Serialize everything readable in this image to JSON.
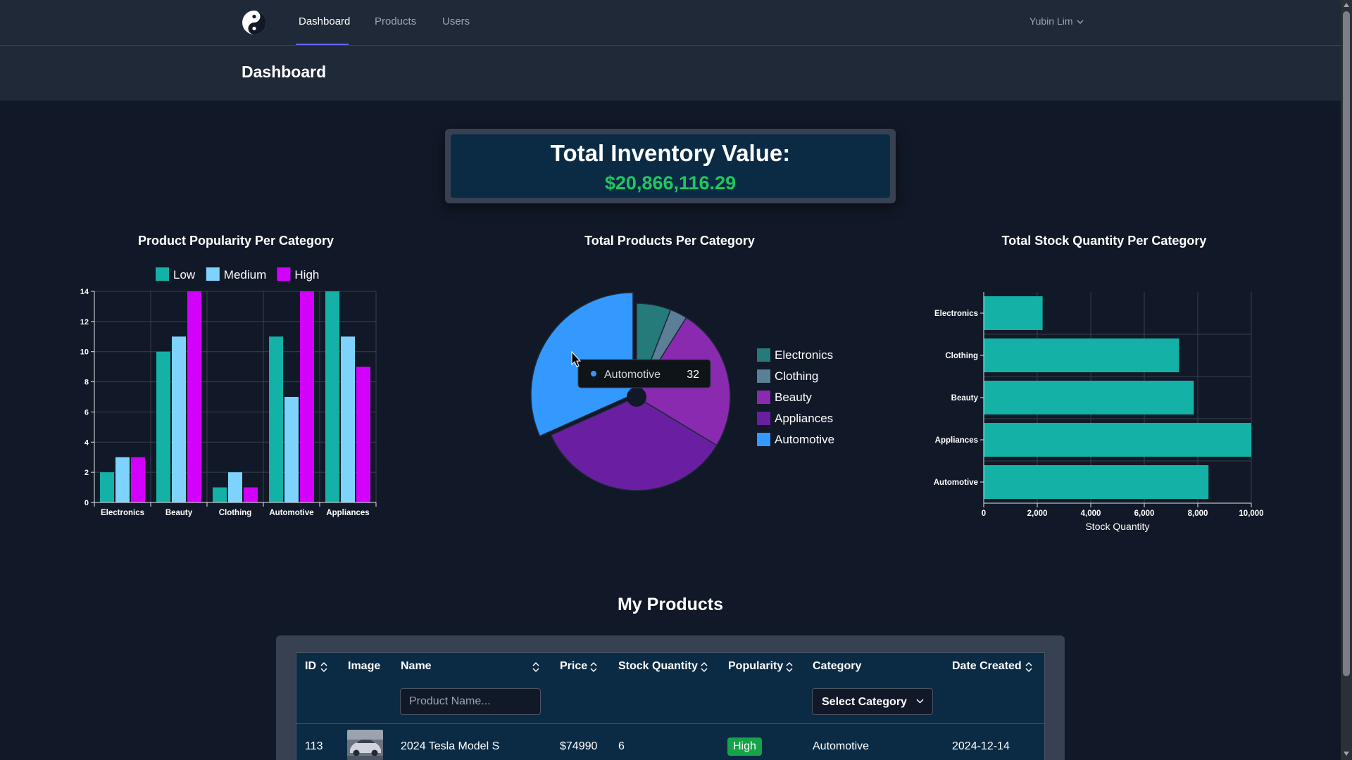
{
  "nav": {
    "logo_icon": "yin-yang-icon",
    "links": [
      {
        "label": "Dashboard",
        "active": true
      },
      {
        "label": "Products",
        "active": false
      },
      {
        "label": "Users",
        "active": false
      }
    ],
    "user_name": "Yubin Lim"
  },
  "header": {
    "title": "Dashboard"
  },
  "inventory": {
    "title": "Total Inventory Value:",
    "value": "$20,866,116.29"
  },
  "colors": {
    "teal": "#13b1a6",
    "light_blue": "#7dd3fc",
    "magenta": "#d400ff",
    "electronics_slice": "#257a7a",
    "clothing_slice": "#5b7f96",
    "beauty_slice": "#8a2ab0",
    "appliances_slice": "#6a1fa3",
    "automotive_slice": "#3399ff",
    "green_value": "#22c55e",
    "badge_high": "#16a34a"
  },
  "chart_data": [
    {
      "type": "bar",
      "title": "Product Popularity Per Category",
      "categories": [
        "Electronics",
        "Beauty",
        "Clothing",
        "Automotive",
        "Appliances"
      ],
      "series": [
        {
          "name": "Low",
          "color": "#13b1a6",
          "values": [
            2,
            10,
            1,
            11,
            14
          ]
        },
        {
          "name": "Medium",
          "color": "#7dd3fc",
          "values": [
            3,
            11,
            2,
            7,
            11
          ]
        },
        {
          "name": "High",
          "color": "#d400ff",
          "values": [
            3,
            14,
            1,
            14,
            9
          ]
        }
      ],
      "ylim": [
        0,
        14
      ],
      "yticks": [
        "0",
        "2",
        "4",
        "6",
        "8",
        "10",
        "12",
        "14"
      ],
      "legend": "top",
      "grid": true
    },
    {
      "type": "pie",
      "title": "Total Products Per Category",
      "labels": [
        "Electronics",
        "Clothing",
        "Beauty",
        "Appliances",
        "Automotive"
      ],
      "values": [
        6,
        3,
        25,
        35,
        32
      ],
      "colors": [
        "#257a7a",
        "#5b7f96",
        "#8a2ab0",
        "#6a1fa3",
        "#3399ff"
      ],
      "legend": "right",
      "tooltip": {
        "label": "Automotive",
        "value": "32"
      }
    },
    {
      "type": "bar",
      "orientation": "horizontal",
      "title": "Total Stock Quantity Per Category",
      "categories": [
        "Electronics",
        "Clothing",
        "Beauty",
        "Appliances",
        "Automotive"
      ],
      "values": [
        2200,
        7300,
        7850,
        10000,
        8400
      ],
      "color": "#13b1a6",
      "xlabel": "Stock Quantity",
      "xlim": [
        0,
        10000
      ],
      "xticks": [
        "0",
        "2,000",
        "4,000",
        "6,000",
        "8,000",
        "10,000"
      ],
      "grid": true
    }
  ],
  "products": {
    "title": "My Products",
    "columns": [
      "ID",
      "Image",
      "Name",
      "Price",
      "Stock Quantity",
      "Popularity",
      "Category",
      "Date Created"
    ],
    "name_placeholder": "Product Name...",
    "category_select": "Select Category",
    "rows": [
      {
        "id": "113",
        "image_icon": "car-thumbnail",
        "name": "2024 Tesla Model S",
        "price": "$74990",
        "stock": "6",
        "popularity": "High",
        "category": "Automotive",
        "date": "2024-12-14"
      }
    ]
  }
}
